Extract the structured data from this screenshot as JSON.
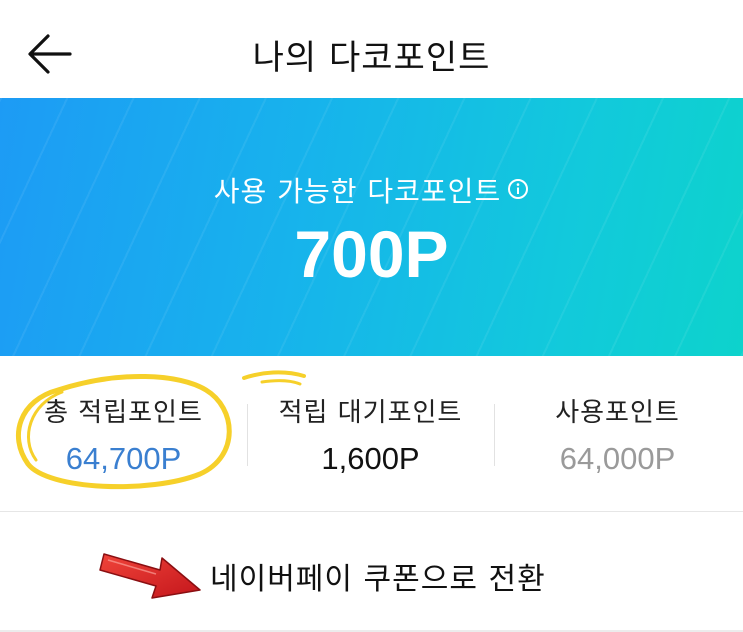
{
  "header": {
    "title": "나의 다코포인트",
    "back_icon": "arrow-left-icon"
  },
  "banner": {
    "label": "사용 가능한 다코포인트",
    "info_icon": "info-circle-icon",
    "amount": "700P",
    "gradient_start": "#1d9bf5",
    "gradient_end": "#0dd3cc"
  },
  "stats": [
    {
      "label": "총 적립포인트",
      "value": "64,700P",
      "color": "#3a7fd0"
    },
    {
      "label": "적립 대기포인트",
      "value": "1,600P",
      "color": "#111111"
    },
    {
      "label": "사용포인트",
      "value": "64,000P",
      "color": "#9a9a9a"
    }
  ],
  "convert": {
    "label": "네이버페이 쿠폰으로 전환"
  },
  "annotations": {
    "highlight_color": "#f6d02a",
    "arrow_color": "#e8262a"
  }
}
